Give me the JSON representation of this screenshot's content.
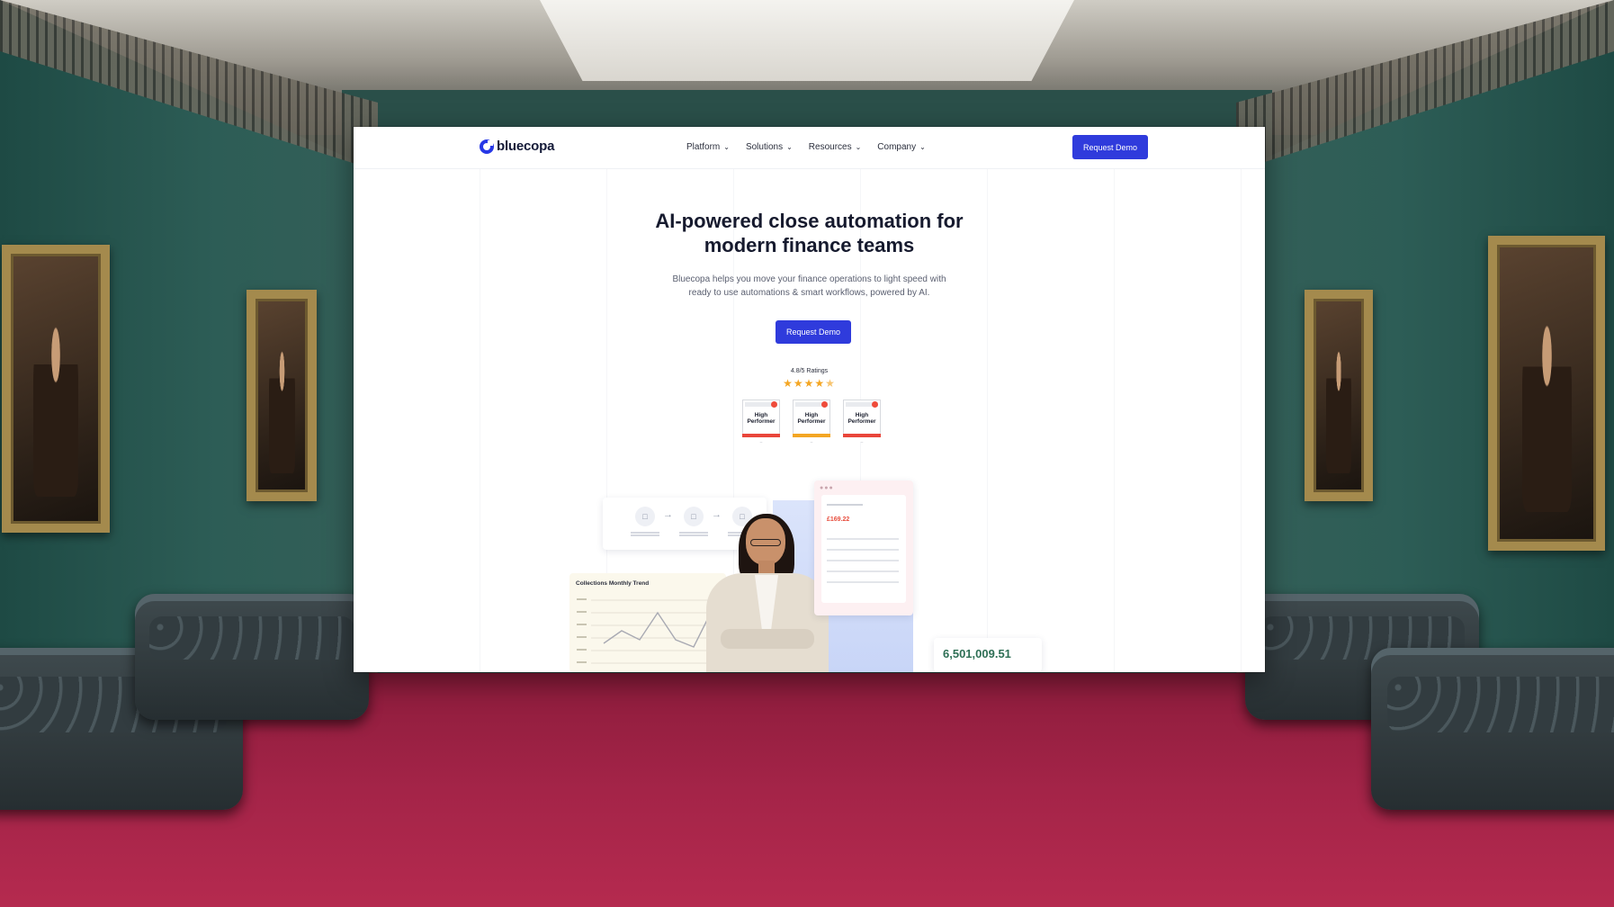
{
  "site": {
    "brand": "bluecopa",
    "nav": {
      "items": [
        {
          "label": "Platform"
        },
        {
          "label": "Solutions"
        },
        {
          "label": "Resources"
        },
        {
          "label": "Company"
        }
      ],
      "cta_label": "Request Demo"
    },
    "hero": {
      "title_line1": "AI-powered close automation for",
      "title_line2": "modern finance teams",
      "subtitle_line1": "Bluecopa helps you move your finance operations to light speed with",
      "subtitle_line2": "ready to use automations & smart workflows, powered by AI.",
      "cta_label": "Request Demo",
      "ratings_label": "4.8/5 Ratings",
      "rating_value": 4.8,
      "rating_max": 5
    },
    "badges": [
      {
        "line1": "High",
        "line2": "Performer",
        "accent": "#e9453a"
      },
      {
        "line1": "High",
        "line2": "Performer",
        "accent": "#f3a623"
      },
      {
        "line1": "High",
        "line2": "Performer",
        "accent": "#e9453a"
      }
    ],
    "illustration": {
      "trend_title": "Collections Monthly Trend",
      "report_amount": "£169.22",
      "big_amount": "6,501,009.51"
    }
  },
  "colors": {
    "primary": "#2f3bdc",
    "brand": "#2738e6",
    "carpet": "#a42448",
    "wall": "#2d5d56",
    "amount_green": "#2e6f55"
  },
  "icons": {
    "logo": "bluecopa-logo-icon",
    "chevron": "chevron-down-icon",
    "star": "star-icon"
  }
}
